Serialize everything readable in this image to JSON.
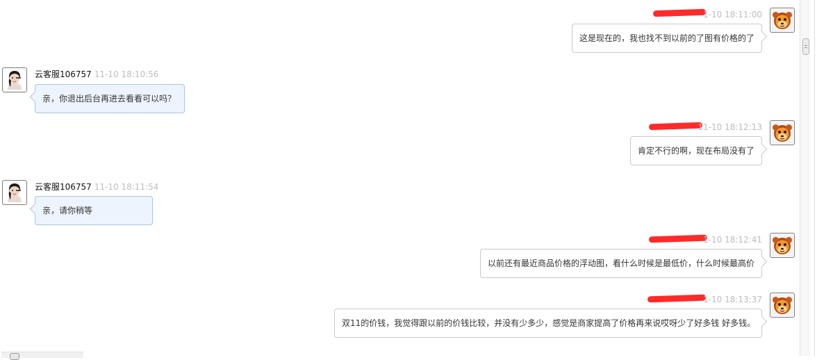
{
  "messages": [
    {
      "side": "right",
      "nick": "",
      "time": "1-10 18:11:00",
      "text": "这是现在的，我也找不到以前的了图有价格的了",
      "avatar": "bear-avatar-icon"
    },
    {
      "side": "left",
      "nick": "云客服106757",
      "time": "11-10 18:10:56",
      "text": "亲，你退出后台再进去看看可以吗？",
      "avatar": "agent-avatar-icon"
    },
    {
      "side": "right",
      "nick": "",
      "time": "11-10 18:12:13",
      "text": "肯定不行的啊，现在布局没有了",
      "avatar": "bear-avatar-icon"
    },
    {
      "side": "left",
      "nick": "云客服106757",
      "time": "11-10 18:11:54",
      "text": "亲，请你稍等",
      "avatar": "agent-avatar-icon"
    },
    {
      "side": "right",
      "nick": "",
      "time": "1-10 18:12:41",
      "text": "以前还有最近商品价格的浮动图，看什么时候是最低价，什么时候最高价",
      "avatar": "bear-avatar-icon"
    },
    {
      "side": "right",
      "nick": "",
      "time": "1-10 18:13:37",
      "text": "双11的价钱，我觉得跟以前的价钱比较，并没有少多少，感觉是商家提高了价格再来说哎呀少了好多钱 好多钱。",
      "avatar": "bear-avatar-icon"
    }
  ],
  "colors": {
    "redaction": "#ff2a2a",
    "timestamp": "#bdbdbd",
    "incoming_bubble": "#eef4fd",
    "incoming_border": "#a9c3e6",
    "outgoing_border": "#c9c9c9"
  }
}
